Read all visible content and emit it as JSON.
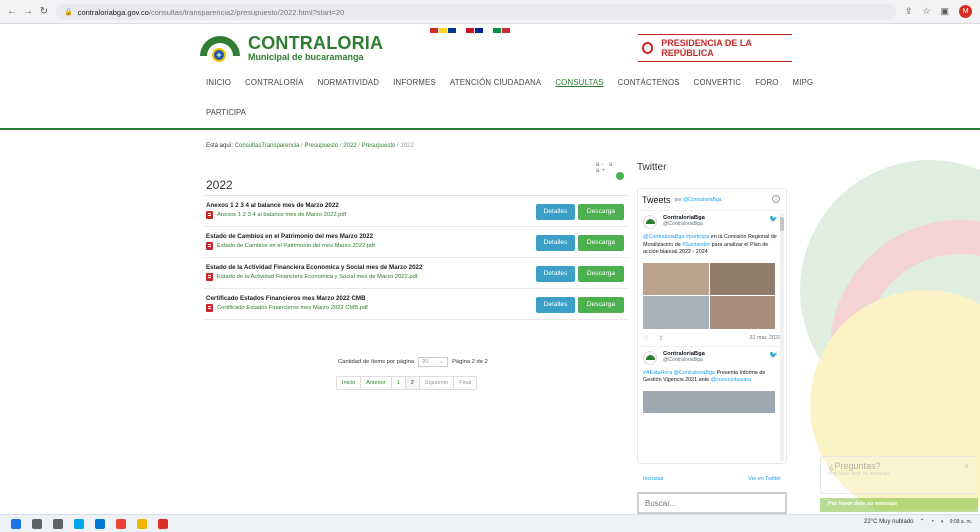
{
  "browser": {
    "url_host": "contraloriabga.gov.co",
    "url_path": "/consultas/transparencia2/presupuesto/2022.html?start=20",
    "profile_initial": "M"
  },
  "header": {
    "logo_title": "CONTRALORIA",
    "logo_subtitle": "Municipal de bucaramanga",
    "presidencia": "PRESIDENCIA DE LA REPÚBLICA",
    "flag_colors": [
      "#d52b1e",
      "#fcd116",
      "#003893",
      "#ffffff",
      "#ce1126",
      "#002395",
      "#ffffff",
      "#009246",
      "#ce2b37",
      "#ffffff"
    ]
  },
  "nav": {
    "items": [
      "INICIO",
      "CONTRALORÍA",
      "NORMATIVIDAD",
      "INFORMES",
      "ATENCIÓN CIUDADANA",
      "CONSULTAS",
      "CONTÁCTENOS",
      "CONVERTIC",
      "FORO",
      "MIPG"
    ],
    "row2": "PARTICIPA"
  },
  "breadcrumb": {
    "prefix": "Está aquí:",
    "items": [
      "Consultas",
      "Transparencia",
      "Presupuesto",
      "2022",
      "Presupuesto"
    ],
    "current": "2022"
  },
  "content": {
    "tools": "a- a a+",
    "heading": "2022",
    "details_label": "Detalles",
    "download_label": "Descarga",
    "documents": [
      {
        "title": "Anexos 1 2 3 4 al balance mes de Marzo 2022",
        "file": "Anexos 1 2 3 4 al balance mes de Marzo 2022.pdf"
      },
      {
        "title": "Estado de Cambios en el Patrimonio del mes Marzo 2022",
        "file": "Estado de Cambios en el Patrimonio del mes Marzo 2022.pdf"
      },
      {
        "title": "Estado de la Actividad Financiera Economica y Social mes de Marzo 2022",
        "file": "Estado de la Actividad Financiera Economica y Social mes de Marzo 2022.pdf"
      },
      {
        "title": "Certificado Estados Financieros mes Marzo 2022 CMB",
        "file": "Certificado Estados Financieros mes Marzo 2022 CMB.pdf"
      }
    ],
    "pagination": {
      "items_label": "Cantidad de ítems por página",
      "items_value": "20",
      "page_info": "Página 2 de 2",
      "links": [
        "Inicio",
        "Anterior",
        "1",
        "2",
        "Siguiente",
        "Final"
      ]
    }
  },
  "twitter": {
    "heading": "Twitter",
    "widget_title": "Tweets",
    "widget_by": "por",
    "widget_handle": "@ContraloriaBga",
    "tweets": [
      {
        "name": "ContraloriaBga",
        "handle": "@ContraloriaBga",
        "text_hl1": "@ContraloriaBga #participa",
        "text": " en la Comisión Regional de Moralización de ",
        "text_hl2": "#Santander",
        "text_end": " para analizar el Plan de acción bianual 2022 - 2024",
        "date": "31 mar. 2022"
      },
      {
        "name": "ContraloriaBga",
        "handle": "@ContraloriaBga",
        "text_hl1": "#AEstaHora @ContraloriaBga",
        "text": " Presenta Informe de Gestión Vigencia 2021 ante ",
        "text_hl2": "@concejobucara",
        "text_end": ""
      }
    ],
    "embed_label": "Incrustar",
    "view_label": "Ver en Twitter",
    "search_placeholder": "Buscar..."
  },
  "chat": {
    "title": "¿Preguntas?",
    "subtitle": "Por favor deje su mensaje",
    "bar": "Por favor deje su mensaje"
  },
  "taskbar": {
    "weather": "22°C  Muy nublado",
    "time": "9:09 a. m.",
    "icon_colors": [
      "#1a73e8",
      "#5f6368",
      "#5f6368",
      "#00a4ef",
      "#0078d4",
      "#ea4335",
      "#f2b600",
      "#d93025"
    ]
  }
}
